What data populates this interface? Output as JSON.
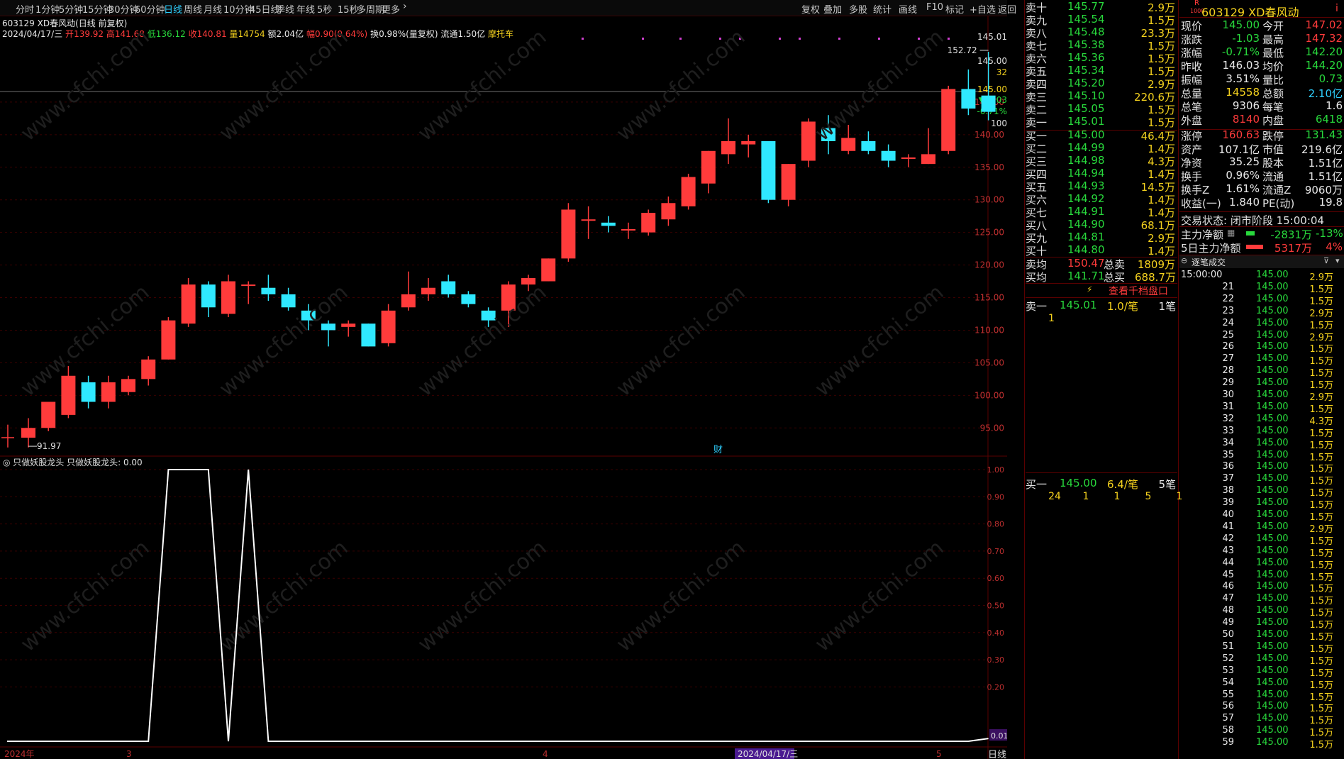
{
  "toolbar": {
    "periods": [
      "分时",
      "1分钟",
      "5分钟",
      "15分钟",
      "30分钟",
      "60分钟",
      "日线",
      "周线",
      "月线",
      "10分钟",
      "45日线",
      "季线",
      "年线",
      "5秒",
      "15秒",
      "多周期",
      "更多"
    ],
    "active_period": "日线",
    "actions": [
      "复权",
      "叠加",
      "多股",
      "统计",
      "画线",
      "F10",
      "标记",
      "+自选",
      "返回"
    ]
  },
  "stock": {
    "code": "603129",
    "name": "XD春风动",
    "title_line": "603129 XD春风动(日线 前复权)",
    "date": "2024/04/17/三",
    "open_label": "开",
    "open": "139.92",
    "high_label": "高",
    "high": "141.68",
    "low_label": "低",
    "low": "136.12",
    "close_label": "收",
    "close": "140.81",
    "vol_label": "量",
    "vol": "14754",
    "amount": "额2.04亿",
    "change": "幅0.90(0.64%)",
    "turnover": "换0.98%(量复权)",
    "float": "流通1.50亿",
    "concept": "摩托车"
  },
  "price_axis": {
    "labels": [
      "145.00",
      "140.00",
      "135.00",
      "130.00",
      "125.00",
      "120.00",
      "115.00",
      "110.00",
      "105.00",
      "100.00",
      "95.00"
    ],
    "top_label": "145.01",
    "marker_price": "145.00",
    "marker_vol": "32",
    "marker_price2": "145.00",
    "marker_chg": "▼-1.03",
    "marker_pct": "-0.71%",
    "marker_100": "100"
  },
  "annotations": {
    "high_mark": "152.72",
    "low_mark": "91.97",
    "cai": "财"
  },
  "indicator": {
    "title": "只做妖股龙头 只做妖股龙头: 0.00",
    "axis": [
      "1.00",
      "0.90",
      "0.80",
      "0.70",
      "0.60",
      "0.50",
      "0.40",
      "0.30",
      "0.20"
    ],
    "current": "0.01"
  },
  "date_axis": {
    "labels": [
      "2024年",
      "3",
      "4",
      "2024/04/17/三",
      "5"
    ],
    "period_tag": "日线"
  },
  "chart_data": {
    "type": "candlestick",
    "ylim": [
      91,
      155
    ],
    "candles": [
      {
        "o": 93.5,
        "c": 95.0,
        "h": 96.5,
        "l": 92.0
      },
      {
        "o": 95.0,
        "c": 99.0,
        "h": 99.0,
        "l": 94.5
      },
      {
        "o": 97.0,
        "c": 103.0,
        "h": 104.5,
        "l": 96.5
      },
      {
        "o": 102.0,
        "c": 99.0,
        "h": 103.0,
        "l": 98.0
      },
      {
        "o": 99.0,
        "c": 102.0,
        "h": 103.0,
        "l": 98.0
      },
      {
        "o": 100.5,
        "c": 102.5,
        "h": 103.0,
        "l": 100.0
      },
      {
        "o": 102.5,
        "c": 105.5,
        "h": 106.0,
        "l": 101.5
      },
      {
        "o": 105.5,
        "c": 111.5,
        "h": 112.0,
        "l": 105.5
      },
      {
        "o": 111.0,
        "c": 117.0,
        "h": 118.0,
        "l": 110.5
      },
      {
        "o": 117.0,
        "c": 113.5,
        "h": 117.5,
        "l": 112.0
      },
      {
        "o": 112.5,
        "c": 117.5,
        "h": 118.5,
        "l": 112.0
      },
      {
        "o": 117.0,
        "c": 117.0,
        "h": 117.5,
        "l": 114.0
      },
      {
        "o": 116.5,
        "c": 115.5,
        "h": 118.5,
        "l": 114.5
      },
      {
        "o": 115.5,
        "c": 113.5,
        "h": 116.5,
        "l": 113.0
      },
      {
        "o": 113.0,
        "c": 111.5,
        "h": 114.0,
        "l": 110.0
      },
      {
        "o": 111.0,
        "c": 110.0,
        "h": 111.5,
        "l": 107.5
      },
      {
        "o": 110.5,
        "c": 111.0,
        "h": 111.5,
        "l": 109.0
      },
      {
        "o": 111.0,
        "c": 107.5,
        "h": 111.0,
        "l": 107.5
      },
      {
        "o": 108.0,
        "c": 113.0,
        "h": 114.0,
        "l": 107.5
      },
      {
        "o": 113.5,
        "c": 115.5,
        "h": 119.0,
        "l": 113.0
      },
      {
        "o": 115.5,
        "c": 116.5,
        "h": 118.0,
        "l": 114.5
      },
      {
        "o": 117.5,
        "c": 115.5,
        "h": 118.5,
        "l": 115.0
      },
      {
        "o": 115.5,
        "c": 114.0,
        "h": 116.0,
        "l": 113.5
      },
      {
        "o": 113.0,
        "c": 111.5,
        "h": 113.5,
        "l": 110.5
      },
      {
        "o": 113.0,
        "c": 117.0,
        "h": 117.5,
        "l": 110.5
      },
      {
        "o": 117.0,
        "c": 118.0,
        "h": 118.5,
        "l": 116.0
      },
      {
        "o": 117.5,
        "c": 121.0,
        "h": 121.0,
        "l": 117.5
      },
      {
        "o": 121.0,
        "c": 128.5,
        "h": 129.5,
        "l": 120.5
      },
      {
        "o": 127.0,
        "c": 127.0,
        "h": 129.0,
        "l": 124.0
      },
      {
        "o": 126.5,
        "c": 126.0,
        "h": 127.5,
        "l": 125.0
      },
      {
        "o": 125.5,
        "c": 125.5,
        "h": 126.5,
        "l": 124.0
      },
      {
        "o": 125.0,
        "c": 128.0,
        "h": 128.5,
        "l": 124.5
      },
      {
        "o": 127.0,
        "c": 129.5,
        "h": 130.5,
        "l": 126.0
      },
      {
        "o": 129.0,
        "c": 133.5,
        "h": 134.0,
        "l": 128.5
      },
      {
        "o": 132.5,
        "c": 137.5,
        "h": 137.5,
        "l": 131.0
      },
      {
        "o": 137.0,
        "c": 139.0,
        "h": 142.5,
        "l": 135.5
      },
      {
        "o": 138.5,
        "c": 139.0,
        "h": 140.0,
        "l": 136.5
      },
      {
        "o": 139.0,
        "c": 130.0,
        "h": 139.0,
        "l": 129.5
      },
      {
        "o": 130.0,
        "c": 135.5,
        "h": 135.5,
        "l": 129.0
      },
      {
        "o": 136.0,
        "c": 142.0,
        "h": 142.5,
        "l": 135.0
      },
      {
        "o": 141.0,
        "c": 139.0,
        "h": 143.0,
        "l": 137.0
      },
      {
        "o": 137.5,
        "c": 139.5,
        "h": 141.5,
        "l": 137.0
      },
      {
        "o": 139.0,
        "c": 137.5,
        "h": 140.5,
        "l": 137.0
      },
      {
        "o": 137.5,
        "c": 136.0,
        "h": 138.5,
        "l": 135.0
      },
      {
        "o": 136.5,
        "c": 136.5,
        "h": 137.0,
        "l": 135.0
      },
      {
        "o": 135.5,
        "c": 137.0,
        "h": 141.0,
        "l": 135.5
      },
      {
        "o": 137.5,
        "c": 147.0,
        "h": 147.5,
        "l": 137.0
      },
      {
        "o": 147.0,
        "c": 144.0,
        "h": 150.0,
        "l": 143.0
      },
      {
        "o": 146.0,
        "c": 143.5,
        "h": 152.72,
        "l": 142.2
      }
    ],
    "indicator_values": [
      0,
      0,
      0,
      0,
      0,
      0,
      0,
      1,
      1,
      1,
      0,
      1,
      0,
      0,
      0,
      0,
      0,
      0,
      0,
      0,
      0,
      0,
      0,
      0,
      0,
      0,
      0,
      0,
      0,
      0,
      0,
      0,
      0,
      0,
      0,
      0,
      0,
      0,
      0,
      0,
      0,
      0,
      0,
      0,
      0,
      0,
      0,
      0,
      0.01
    ]
  },
  "orderbook": {
    "asks": [
      {
        "label": "卖十",
        "price": "145.77",
        "vol": "2.9万"
      },
      {
        "label": "卖九",
        "price": "145.54",
        "vol": "1.5万"
      },
      {
        "label": "卖八",
        "price": "145.48",
        "vol": "23.3万"
      },
      {
        "label": "卖七",
        "price": "145.38",
        "vol": "1.5万"
      },
      {
        "label": "卖六",
        "price": "145.36",
        "vol": "1.5万"
      },
      {
        "label": "卖五",
        "price": "145.34",
        "vol": "1.5万"
      },
      {
        "label": "卖四",
        "price": "145.20",
        "vol": "2.9万"
      },
      {
        "label": "卖三",
        "price": "145.10",
        "vol": "220.6万"
      },
      {
        "label": "卖二",
        "price": "145.05",
        "vol": "1.5万"
      },
      {
        "label": "卖一",
        "price": "145.01",
        "vol": "1.5万"
      }
    ],
    "bids": [
      {
        "label": "买一",
        "price": "145.00",
        "vol": "46.4万"
      },
      {
        "label": "买二",
        "price": "144.99",
        "vol": "1.4万"
      },
      {
        "label": "买三",
        "price": "144.98",
        "vol": "4.3万"
      },
      {
        "label": "买四",
        "price": "144.94",
        "vol": "1.4万"
      },
      {
        "label": "买五",
        "price": "144.93",
        "vol": "14.5万"
      },
      {
        "label": "买六",
        "price": "144.92",
        "vol": "1.4万"
      },
      {
        "label": "买七",
        "price": "144.91",
        "vol": "1.4万"
      },
      {
        "label": "买八",
        "price": "144.90",
        "vol": "68.1万"
      },
      {
        "label": "买九",
        "price": "144.81",
        "vol": "2.9万"
      },
      {
        "label": "买十",
        "price": "144.80",
        "vol": "1.4万"
      }
    ],
    "ask_avg_label": "卖均",
    "ask_avg": "150.47",
    "total_sell_label": "总卖",
    "total_sell": "1809万",
    "bid_avg_label": "买均",
    "bid_avg": "141.71",
    "total_buy_label": "总买",
    "total_buy": "688.7万",
    "view_depth": "查看千档盘口",
    "sell1": {
      "label": "卖一",
      "price": "145.01",
      "per": "1.0/笔",
      "count": "1笔",
      "queue": [
        "1"
      ]
    },
    "buy1": {
      "label": "买一",
      "price": "145.00",
      "per": "6.4/笔",
      "count": "5笔",
      "queue": [
        "24",
        "1",
        "1",
        "5",
        "1"
      ]
    }
  },
  "quote": {
    "header": "603129 XD春风动",
    "rows": [
      {
        "l1": "现价",
        "v1": "145.00",
        "c1": "green",
        "l2": "今开",
        "v2": "147.02",
        "c2": "red"
      },
      {
        "l1": "涨跌",
        "v1": "-1.03",
        "c1": "green",
        "l2": "最高",
        "v2": "147.32",
        "c2": "red"
      },
      {
        "l1": "涨幅",
        "v1": "-0.71%",
        "c1": "green",
        "l2": "最低",
        "v2": "142.20",
        "c2": "green"
      },
      {
        "l1": "昨收",
        "v1": "146.03",
        "c1": "white",
        "l2": "均价",
        "v2": "144.20",
        "c2": "green"
      },
      {
        "l1": "振幅",
        "v1": "3.51%",
        "c1": "white",
        "l2": "量比",
        "v2": "0.73",
        "c2": "green"
      },
      {
        "l1": "总量",
        "v1": "14558",
        "c1": "yellow",
        "l2": "总额",
        "v2": "2.10亿",
        "c2": "cyan"
      },
      {
        "l1": "总笔",
        "v1": "9306",
        "c1": "white",
        "l2": "每笔",
        "v2": "1.6",
        "c2": "white"
      },
      {
        "l1": "外盘",
        "v1": "8140",
        "c1": "red",
        "l2": "内盘",
        "v2": "6418",
        "c2": "green"
      }
    ],
    "rows2": [
      {
        "l1": "涨停",
        "v1": "160.63",
        "c1": "red",
        "l2": "跌停",
        "v2": "131.43",
        "c2": "green"
      },
      {
        "l1": "资产",
        "v1": "107.1亿",
        "c1": "white",
        "l2": "市值",
        "v2": "219.6亿",
        "c2": "white"
      },
      {
        "l1": "净资",
        "v1": "35.25",
        "c1": "white",
        "l2": "股本",
        "v2": "1.51亿",
        "c2": "white"
      },
      {
        "l1": "换手",
        "v1": "0.96%",
        "c1": "white",
        "l2": "流通",
        "v2": "1.51亿",
        "c2": "white"
      },
      {
        "l1": "换手Z",
        "v1": "1.61%",
        "c1": "white",
        "l2": "流通Z",
        "v2": "9060万",
        "c2": "white"
      },
      {
        "l1": "收益(一)",
        "v1": "1.840",
        "c1": "white",
        "l2": "PE(动)",
        "v2": "19.8",
        "c2": "white"
      }
    ],
    "trade_status": "交易状态: 闭市阶段 15:00:04",
    "main_net_label": "主力净额",
    "main_net": "-2831万",
    "main_net_pct": "-13%",
    "main5_label": "5日主力净额",
    "main5": "5317万",
    "main5_pct": "4%"
  },
  "ticks": {
    "title": "逐笔成交",
    "first_time": "15:00:00",
    "rows": [
      {
        "t": "15:00:00",
        "p": "145.00",
        "v": "2.9万"
      },
      {
        "t": "21",
        "p": "145.00",
        "v": "1.5万"
      },
      {
        "t": "22",
        "p": "145.00",
        "v": "1.5万"
      },
      {
        "t": "23",
        "p": "145.00",
        "v": "2.9万"
      },
      {
        "t": "24",
        "p": "145.00",
        "v": "1.5万"
      },
      {
        "t": "25",
        "p": "145.00",
        "v": "2.9万"
      },
      {
        "t": "26",
        "p": "145.00",
        "v": "1.5万"
      },
      {
        "t": "27",
        "p": "145.00",
        "v": "1.5万"
      },
      {
        "t": "28",
        "p": "145.00",
        "v": "1.5万"
      },
      {
        "t": "29",
        "p": "145.00",
        "v": "1.5万"
      },
      {
        "t": "30",
        "p": "145.00",
        "v": "2.9万"
      },
      {
        "t": "31",
        "p": "145.00",
        "v": "1.5万"
      },
      {
        "t": "32",
        "p": "145.00",
        "v": "4.3万"
      },
      {
        "t": "33",
        "p": "145.00",
        "v": "1.5万"
      },
      {
        "t": "34",
        "p": "145.00",
        "v": "1.5万"
      },
      {
        "t": "35",
        "p": "145.00",
        "v": "1.5万"
      },
      {
        "t": "36",
        "p": "145.00",
        "v": "1.5万"
      },
      {
        "t": "37",
        "p": "145.00",
        "v": "1.5万"
      },
      {
        "t": "38",
        "p": "145.00",
        "v": "1.5万"
      },
      {
        "t": "39",
        "p": "145.00",
        "v": "1.5万"
      },
      {
        "t": "40",
        "p": "145.00",
        "v": "1.5万"
      },
      {
        "t": "41",
        "p": "145.00",
        "v": "2.9万"
      },
      {
        "t": "42",
        "p": "145.00",
        "v": "1.5万"
      },
      {
        "t": "43",
        "p": "145.00",
        "v": "1.5万"
      },
      {
        "t": "44",
        "p": "145.00",
        "v": "1.5万"
      },
      {
        "t": "45",
        "p": "145.00",
        "v": "1.5万"
      },
      {
        "t": "46",
        "p": "145.00",
        "v": "1.5万"
      },
      {
        "t": "47",
        "p": "145.00",
        "v": "1.5万"
      },
      {
        "t": "48",
        "p": "145.00",
        "v": "1.5万"
      },
      {
        "t": "49",
        "p": "145.00",
        "v": "1.5万"
      },
      {
        "t": "50",
        "p": "145.00",
        "v": "1.5万"
      },
      {
        "t": "51",
        "p": "145.00",
        "v": "1.5万"
      },
      {
        "t": "52",
        "p": "145.00",
        "v": "1.5万"
      },
      {
        "t": "53",
        "p": "145.00",
        "v": "1.5万"
      },
      {
        "t": "54",
        "p": "145.00",
        "v": "1.5万"
      },
      {
        "t": "55",
        "p": "145.00",
        "v": "1.5万"
      },
      {
        "t": "56",
        "p": "145.00",
        "v": "1.5万"
      },
      {
        "t": "57",
        "p": "145.00",
        "v": "1.5万"
      },
      {
        "t": "58",
        "p": "145.00",
        "v": "1.5万"
      },
      {
        "t": "59",
        "p": "145.00",
        "v": "1.5万"
      }
    ]
  },
  "colors": {
    "up": "#ff3b3b",
    "down": "#2fe8ff",
    "grid": "#5a0000",
    "indicator": "#ffffff"
  }
}
